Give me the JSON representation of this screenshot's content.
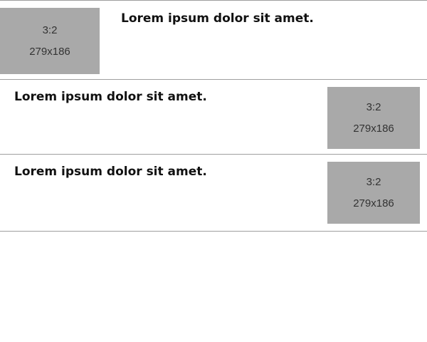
{
  "items": [
    {
      "heading": "Lorem ipsum dolor sit amet.",
      "thumbnail": {
        "ratio": "3:2",
        "size": "279x186"
      }
    },
    {
      "heading": "Lorem ipsum dolor sit amet.",
      "thumbnail": {
        "ratio": "3:2",
        "size": "279x186"
      }
    },
    {
      "heading": "Lorem ipsum dolor sit amet.",
      "thumbnail": {
        "ratio": "3:2",
        "size": "279x186"
      }
    }
  ],
  "colors": {
    "placeholder_bg": "#a9a9a9",
    "divider": "#9e9e9e",
    "heading_text": "#111111",
    "placeholder_text": "#333333"
  }
}
